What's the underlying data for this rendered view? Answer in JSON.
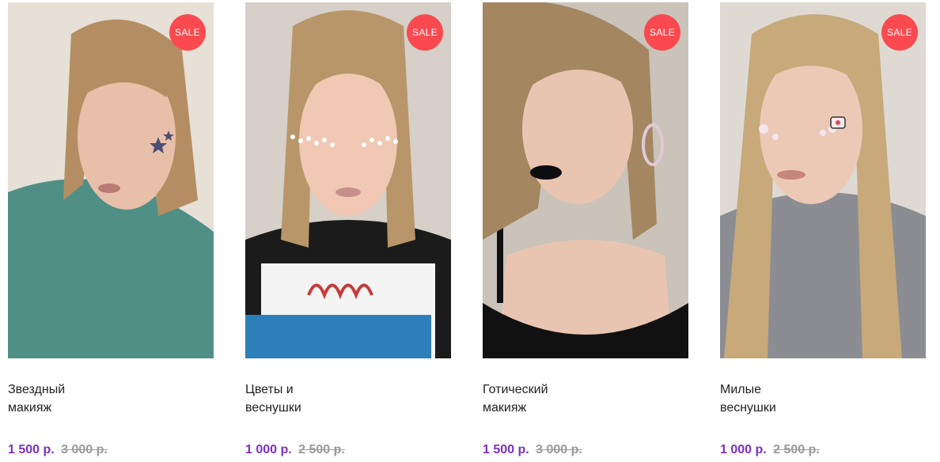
{
  "products": [
    {
      "title": "Звездный\nмакияж",
      "price": "1 500 р.",
      "old_price": "3 000 р.",
      "badge": "SALE",
      "colors": {
        "bg": "#e6e0d6",
        "top": "#4f8f86",
        "hair": "#b48e62",
        "skin": "#e8bfa8",
        "lips": "#b77a76"
      }
    },
    {
      "title": "Цветы и\nвеснушки",
      "price": "1 000 р.",
      "old_price": "2 500 р.",
      "badge": "SALE",
      "colors": {
        "bg": "#d6d0c8",
        "top": "#1b1b1b",
        "hair": "#b89669",
        "skin": "#f0c8b3",
        "lips": "#c5918a"
      }
    },
    {
      "title": "Готический\nмакияж",
      "price": "1 500 р.",
      "old_price": "3 000 р.",
      "badge": "SALE",
      "colors": {
        "bg": "#c9c3ba",
        "top": "#111111",
        "hair": "#a48660",
        "skin": "#e9c5b1",
        "lips": "#0d0d10"
      }
    },
    {
      "title": "Милые\nвеснушки",
      "price": "1 000 р.",
      "old_price": "2 500 р.",
      "badge": "SALE",
      "colors": {
        "bg": "#dedad3",
        "top": "#8b8d93",
        "hair": "#c7a97a",
        "skin": "#ecc9b7",
        "lips": "#c7857b"
      }
    }
  ],
  "accent_color": "#7c2fbf",
  "badge_color": "#fa4a4f"
}
